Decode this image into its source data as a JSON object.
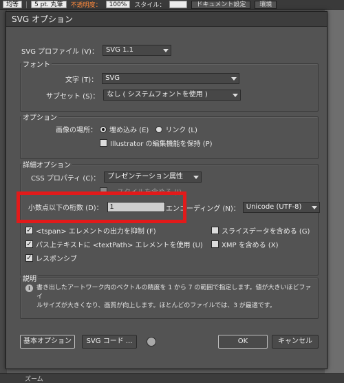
{
  "app_toolbar": {
    "blend_field": "均等",
    "stroke_field": "5 pt. 丸筆",
    "opacity_label": "不透明度：",
    "opacity_value": "100%",
    "style_label": "スタイル：",
    "doc_setup_button": "ドキュメント設定",
    "env_button": "環境"
  },
  "bottom_bar": {
    "label": "ズーム"
  },
  "dialog": {
    "title": "SVG オプション",
    "profile_label": "SVG プロファイル (V)：",
    "profile_value": "SVG 1.1",
    "font_group": {
      "title": "フォント",
      "type_label": "文字 (T)：",
      "type_value": "SVG",
      "subset_label": "サブセット (S)：",
      "subset_value": "なし ( システムフォントを使用 )"
    },
    "options_group": {
      "title": "オプション",
      "image_location_label": "画像の場所：",
      "embed_label": "埋め込み (E)",
      "link_label": "リンク (L)",
      "preserve_label": "Illustrator の編集機能を保持 (P)"
    },
    "advanced_group": {
      "title": "詳細オプション",
      "css_label": "CSS プロパティ (C)：",
      "css_value": "プレゼンテーション属性",
      "hidden_option_label": "…スタイルを含める (I)",
      "decimal_label": "小数点以下の桁数 (D)：",
      "decimal_value": "1",
      "encoding_label": "エンコーディング (N)：",
      "encoding_value": "Unicode (UTF-8)",
      "tspan_label": "<tspan> エレメントの出力を抑制 (F)",
      "slice_label": "スライスデータを含める (G)",
      "textpath_label": "パス上テキストに <textPath> エレメントを使用 (U)",
      "xmp_label": "XMP を含める (X)",
      "responsive_label": "レスポンシブ"
    },
    "description_group": {
      "title": "説明",
      "text_line1": "書き出したアートワーク内のベクトルの精度を 1 から 7 の範囲で指定します。値が大きいほどファイ",
      "text_line2": "ルサイズが大きくなり、画質が向上します。ほとんどのファイルでは、3 が最適です。"
    },
    "buttons": {
      "basic_options": "基本オプション",
      "svg_code": "SVG コード ...",
      "ok": "OK",
      "cancel": "キャンセル"
    }
  },
  "colors": {
    "dialog_bg": "#535353",
    "highlight_red": "#e21a1a",
    "opacity_orange": "#ff8a3c"
  }
}
